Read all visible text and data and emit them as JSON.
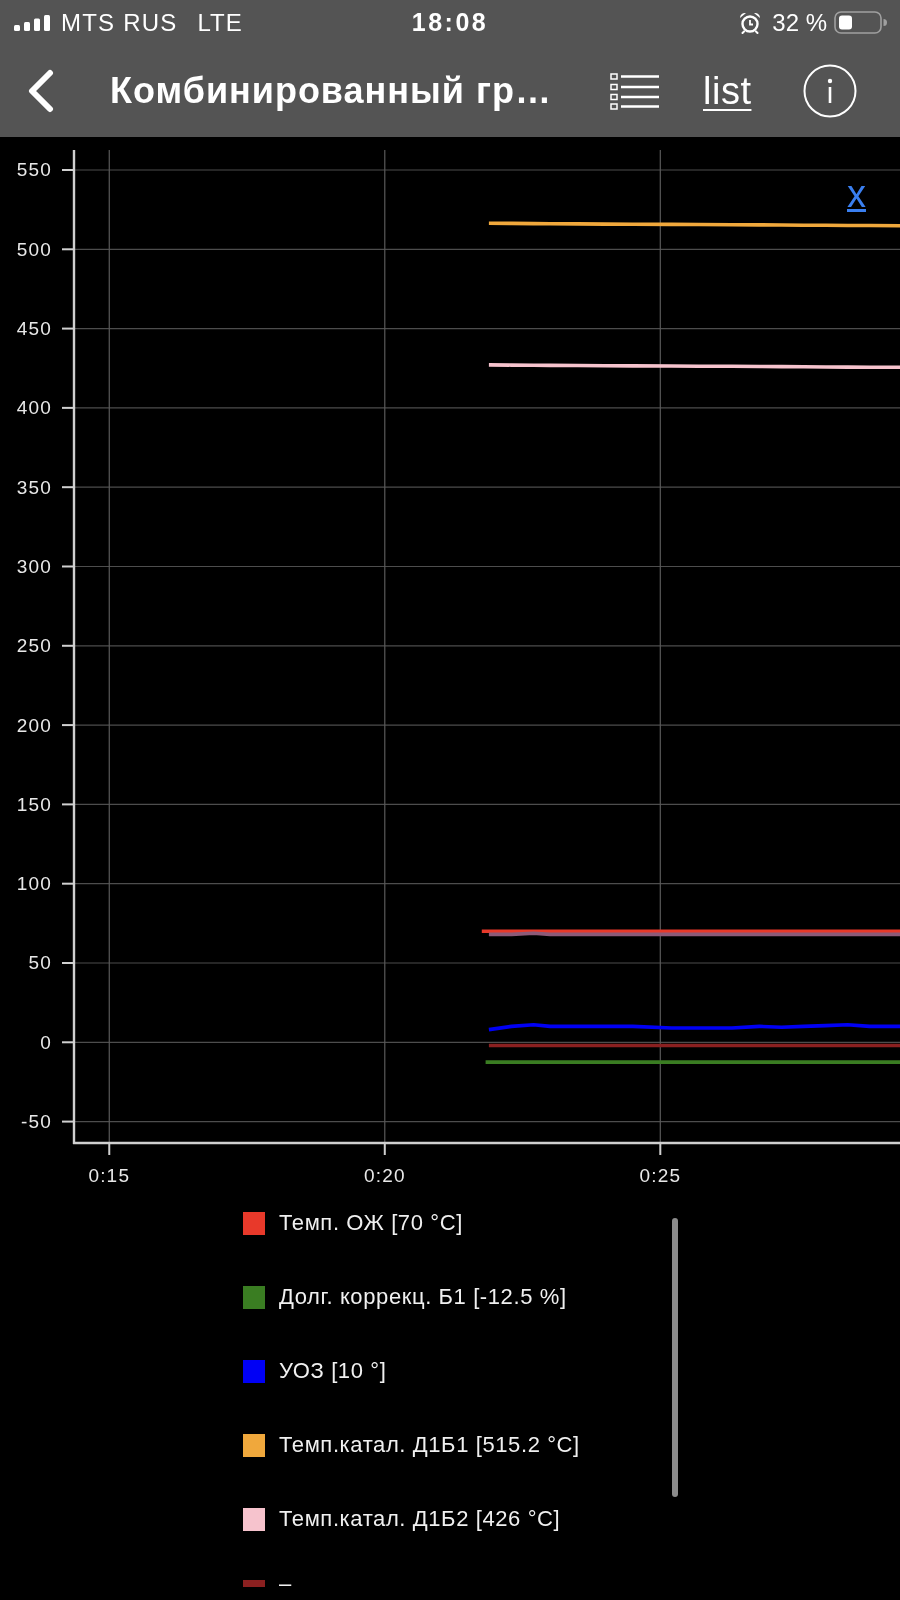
{
  "status_bar": {
    "carrier": "MTS RUS",
    "network": "LTE",
    "time": "18:08",
    "battery": "32 %"
  },
  "nav_bar": {
    "title": "Комбинированный гр…",
    "list_link": "list"
  },
  "chart": {
    "corner_link": "x",
    "chart_data": {
      "type": "line",
      "grid": true,
      "legend": true,
      "x": [
        21.76,
        21.83,
        21.89,
        22.3,
        22.7,
        23.0,
        23.5,
        24.0,
        24.5,
        25.2,
        25.7,
        26.3,
        26.8,
        27.2,
        27.6,
        28.0,
        28.4,
        28.8,
        29.35
      ],
      "xlim": [
        14.36,
        29.35
      ],
      "ylim": [
        -63.5,
        562.6
      ],
      "xticks": [
        {
          "value": 15,
          "label": "0:15"
        },
        {
          "value": 20,
          "label": "0:20"
        },
        {
          "value": 25,
          "label": "0:25"
        }
      ],
      "yticks": [
        -50,
        0,
        50,
        100,
        150,
        200,
        250,
        300,
        350,
        400,
        450,
        500,
        550
      ],
      "series": [
        {
          "name": "Темп. ОЖ [70 °C]",
          "color": "#e8392a",
          "values": [
            70,
            70,
            70,
            70,
            70,
            70,
            70,
            70,
            70,
            70,
            70,
            70,
            70,
            70,
            70,
            70,
            70,
            70,
            70
          ]
        },
        {
          "name": "Долг. коррекц. Б1 [-12.5 %]",
          "color": "#3a7d22",
          "values": [
            null,
            -12.5,
            -12.5,
            -12.5,
            -12.5,
            -12.5,
            -12.5,
            -12.5,
            -12.5,
            -12.5,
            -12.5,
            -12.5,
            -12.5,
            -12.5,
            -12.5,
            -12.5,
            -12.5,
            -12.5,
            -12.5
          ]
        },
        {
          "name": "УОЗ [10 °]",
          "color": "#0000f5",
          "values": [
            null,
            null,
            8,
            10,
            11,
            10,
            10,
            10,
            10,
            9,
            9,
            9,
            10,
            9.5,
            10,
            10.5,
            11,
            10,
            10
          ]
        },
        {
          "name": "Темп.катал. Д1Б1 [515.2 °C]",
          "color": "#f0a83c",
          "values": [
            null,
            null,
            516.4,
            516.3,
            516.2,
            516.1,
            516,
            515.9,
            515.8,
            515.7,
            515.6,
            515.5,
            515.4,
            515.3,
            515.2,
            515.1,
            515,
            515,
            514.9
          ]
        },
        {
          "name": "Темп.катал. Д1Б2 [426 °C]",
          "color": "#f6c3cd",
          "values": [
            null,
            null,
            427.1,
            427,
            426.9,
            426.8,
            426.7,
            426.6,
            426.5,
            426.4,
            426.3,
            426.2,
            426.1,
            426,
            425.9,
            425.8,
            425.7,
            425.6,
            425.6
          ]
        },
        {
          "name": "–",
          "color": "#8b2020",
          "values": [
            null,
            null,
            -2,
            -2,
            -2,
            -2,
            -2,
            -2,
            -2,
            -2,
            -2,
            -2,
            -2,
            -2,
            -2,
            -2,
            -2,
            -2,
            -2
          ]
        },
        {
          "color": "#8d5a78",
          "values": [
            null,
            null,
            68,
            68,
            68.8,
            68,
            68,
            68,
            68,
            68,
            68,
            68,
            68,
            68,
            68,
            68,
            68,
            68,
            68
          ]
        }
      ]
    }
  }
}
